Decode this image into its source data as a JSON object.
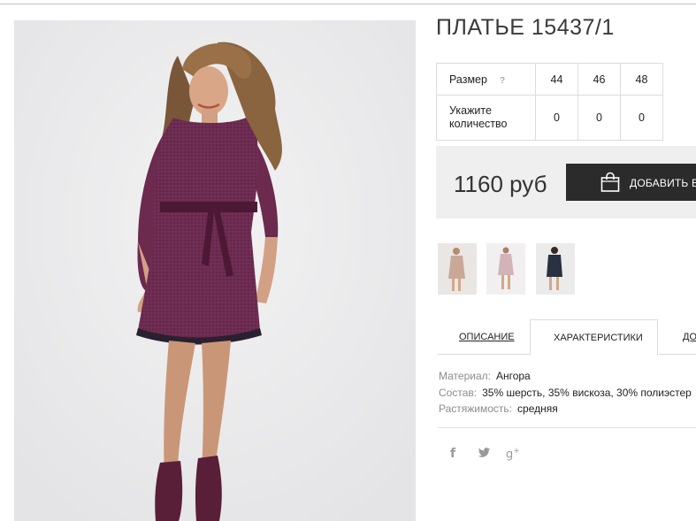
{
  "product": {
    "title": "ПЛАТЬЕ 15437/1"
  },
  "sizes": {
    "size_label": "Размер",
    "help_mark": "?",
    "qty_label": "Укажите количество",
    "columns": [
      {
        "size": "44",
        "qty": "0"
      },
      {
        "size": "46",
        "qty": "0"
      },
      {
        "size": "48",
        "qty": "0"
      }
    ]
  },
  "purchase": {
    "price": "1160 руб",
    "add_label": "ДОБАВИТЬ В"
  },
  "thumbnails": [
    {
      "icon": "dress-photo-beige"
    },
    {
      "icon": "dress-photo-pink"
    },
    {
      "icon": "dress-photo-navy"
    }
  ],
  "tabs": {
    "items": [
      "ОПИСАНИЕ",
      "ХАРАКТЕРИСТИКИ",
      "ДО"
    ],
    "active": "ХАРАКТЕРИСТИКИ"
  },
  "characteristics": [
    {
      "key": "Материал:",
      "value": "Ангора"
    },
    {
      "key": "Состав:",
      "value": "35% шерсть, 35% вискоза, 30% полиэстер"
    },
    {
      "key": "Растяжимость:",
      "value": "средняя"
    }
  ],
  "social": [
    {
      "icon": "facebook-icon",
      "glyph": "f"
    },
    {
      "icon": "twitter-icon",
      "glyph": "🐦"
    },
    {
      "icon": "google-plus-icon",
      "glyph": "g+"
    }
  ],
  "colors": {
    "dress": "#6b2a4e",
    "button": "#2b2b2b",
    "price_box": "#efefef"
  }
}
